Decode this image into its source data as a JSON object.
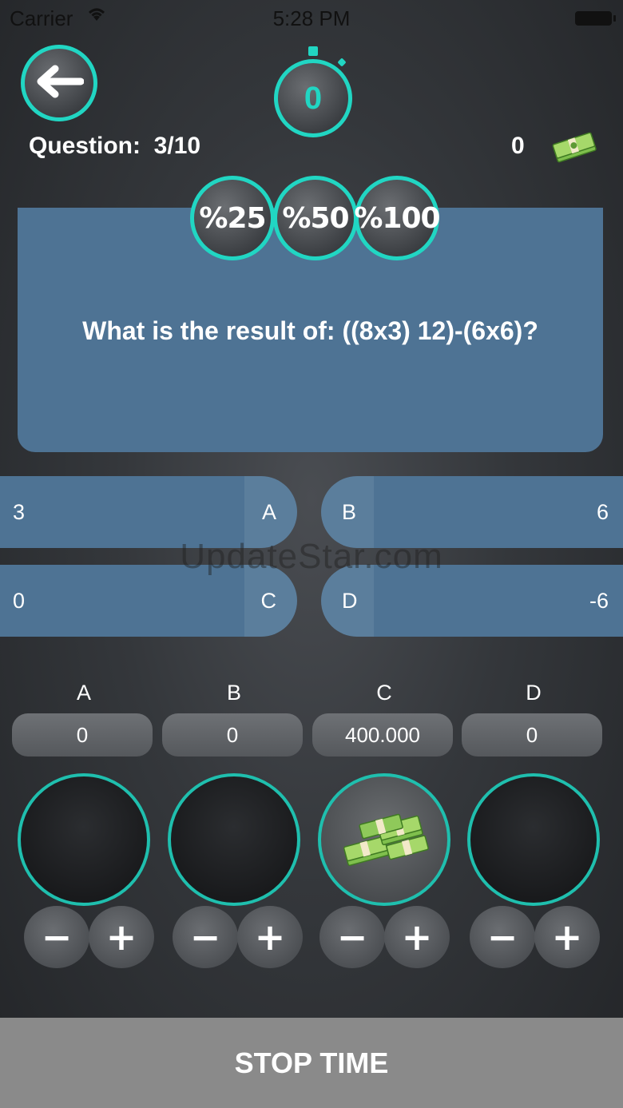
{
  "status_bar": {
    "carrier": "Carrier",
    "time": "5:28 PM"
  },
  "header": {
    "timer_value": "0",
    "question_label": "Question:",
    "question_progress": "3/10",
    "money_count": "0"
  },
  "jokers": [
    {
      "label": "%25"
    },
    {
      "label": "%50"
    },
    {
      "label": "%100"
    }
  ],
  "question": {
    "text": "What is the result of: ((8x3) 12)-(6x6)?"
  },
  "answers": [
    {
      "letter": "A",
      "value": "3"
    },
    {
      "letter": "B",
      "value": "6"
    },
    {
      "letter": "C",
      "value": "0"
    },
    {
      "letter": "D",
      "value": "-6"
    }
  ],
  "watermark": "UpdateStar.com",
  "bets": [
    {
      "letter": "A",
      "amount": "0"
    },
    {
      "letter": "B",
      "amount": "0"
    },
    {
      "letter": "C",
      "amount": "400.000"
    },
    {
      "letter": "D",
      "amount": "0"
    }
  ],
  "controls": {
    "minus": "−",
    "plus": "+"
  },
  "footer": {
    "stop_label": "STOP TIME"
  },
  "colors": {
    "accent": "#21d6c3",
    "card": "#4e7394",
    "footer": "#8a8a8a"
  }
}
